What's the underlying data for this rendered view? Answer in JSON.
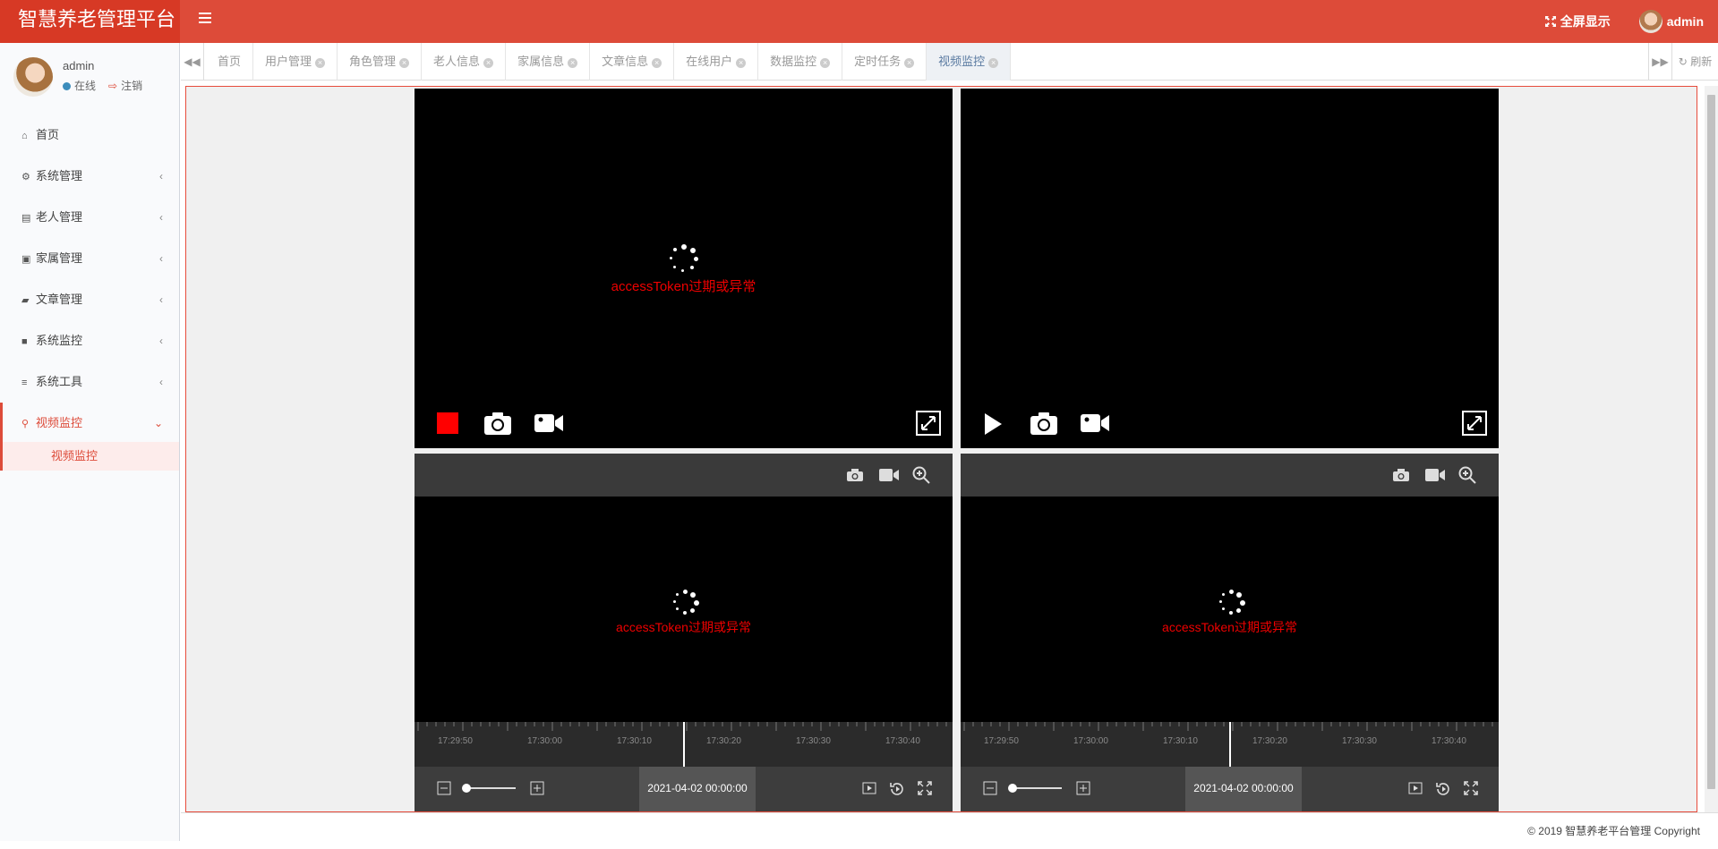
{
  "app": {
    "title": "智慧养老管理平台"
  },
  "header": {
    "fullscreen_label": "全屏显示",
    "user_name": "admin"
  },
  "sidebar": {
    "user": {
      "name": "admin",
      "status": "在线",
      "logout": "注销"
    },
    "items": [
      {
        "label": "首页",
        "icon": "home-icon"
      },
      {
        "label": "系统管理",
        "icon": "gear-icon"
      },
      {
        "label": "老人管理",
        "icon": "id-card-icon"
      },
      {
        "label": "家属管理",
        "icon": "contact-icon"
      },
      {
        "label": "文章管理",
        "icon": "book-icon"
      },
      {
        "label": "系统监控",
        "icon": "video-camera-icon"
      },
      {
        "label": "系统工具",
        "icon": "bars-icon"
      },
      {
        "label": "视频监控",
        "icon": "search-icon"
      }
    ],
    "submenu": {
      "label": "视频监控"
    }
  },
  "tabs": [
    "首页",
    "用户管理",
    "角色管理",
    "老人信息",
    "家属信息",
    "文章信息",
    "在线用户",
    "数据监控",
    "定时任务",
    "视频监控"
  ],
  "tabbar": {
    "refresh_label": "刷新"
  },
  "players": {
    "error_text": "accessToken过期或异常",
    "timeline_labels": [
      "17:29:50",
      "17:30:00",
      "17:30:10",
      "17:30:20",
      "17:30:30",
      "17:30:40"
    ],
    "date_display": "2021-04-02 00:00:00"
  },
  "footer": {
    "copyright": "© 2019 智慧养老平台管理 Copyright"
  },
  "colors": {
    "brand": "#dd4b39",
    "brand_dark": "#d73925",
    "error": "#ee0000"
  }
}
